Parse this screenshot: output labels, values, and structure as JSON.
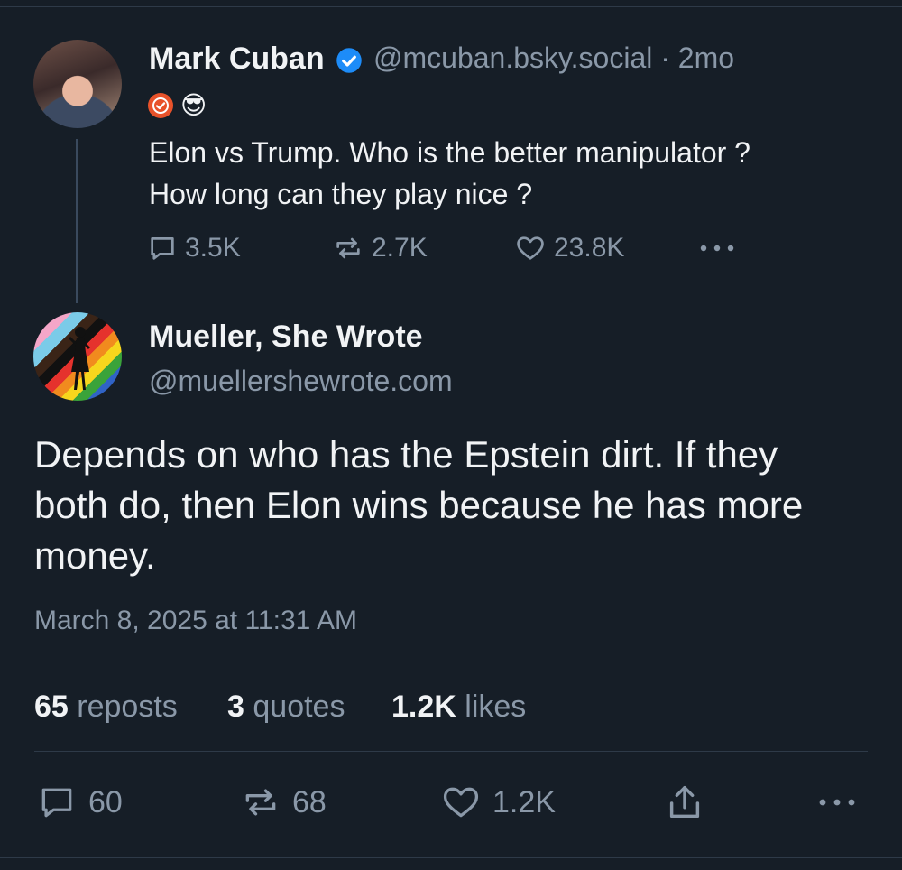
{
  "parent_post": {
    "author_name": "Mark Cuban",
    "handle_and_time": "@mcuban.bsky.social · 2mo",
    "badges": [
      "orange-check-badge",
      "sunglasses-emoji"
    ],
    "badge_emoji": "😎",
    "text_lines": [
      "Elon vs Trump.  Who is the better manipulator ?",
      "How long can they play nice ?"
    ],
    "reply_count": "3.5K",
    "repost_count": "2.7K",
    "like_count": "23.8K"
  },
  "reply_post": {
    "author_name": "Mueller, She Wrote",
    "handle": "@muellershewrote.com",
    "text_lines": [
      "Depends on who has the Epstein dirt. If they",
      "both do, then Elon wins because he has more",
      "money."
    ],
    "timestamp": "March 8, 2025 at 11:31 AM",
    "stats": {
      "reposts_num": "65",
      "reposts_label": "reposts",
      "quotes_num": "3",
      "quotes_label": "quotes",
      "likes_num": "1.2K",
      "likes_label": "likes"
    },
    "reply_count": "60",
    "repost_count": "68",
    "like_count": "1.2K"
  },
  "colors": {
    "background": "#161e27",
    "text_primary": "#f1f3f5",
    "text_secondary": "#8a98a8",
    "verified_blue": "#1d8cf8",
    "badge_orange": "#e8522a"
  }
}
